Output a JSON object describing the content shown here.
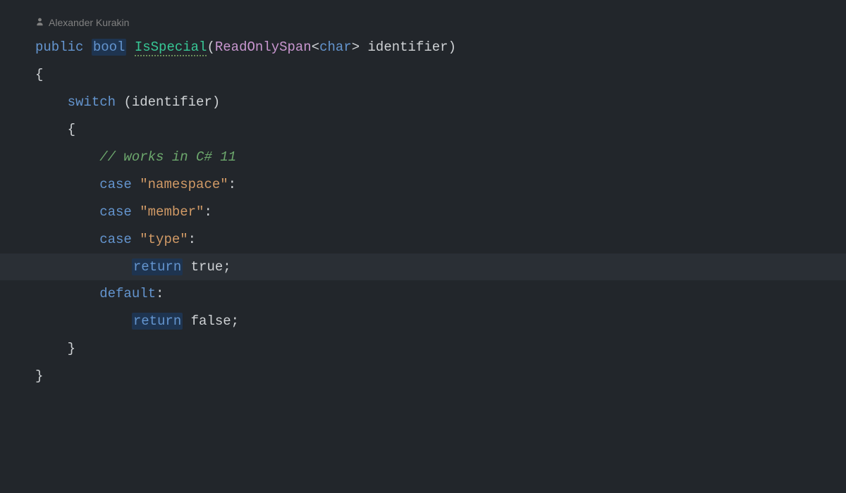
{
  "code_lens": {
    "author": "Alexander Kurakin"
  },
  "code": {
    "keywords": {
      "public": "public",
      "bool": "bool",
      "switch": "switch",
      "case": "case",
      "return": "return",
      "default": "default",
      "char": "char",
      "true": "true",
      "false": "false"
    },
    "method_name": "IsSpecial",
    "type_readonlyspan": "ReadOnlySpan",
    "param_identifier": "identifier",
    "comment_cs11": "// works in C# 11",
    "strings": {
      "namespace": "\"namespace\"",
      "member": "\"member\"",
      "type": "\"type\""
    },
    "punct": {
      "open_paren": "(",
      "close_paren": ")",
      "open_brace": "{",
      "close_brace": "}",
      "open_angle": "<",
      "close_angle": ">",
      "colon": ":",
      "semicolon": ";"
    }
  }
}
